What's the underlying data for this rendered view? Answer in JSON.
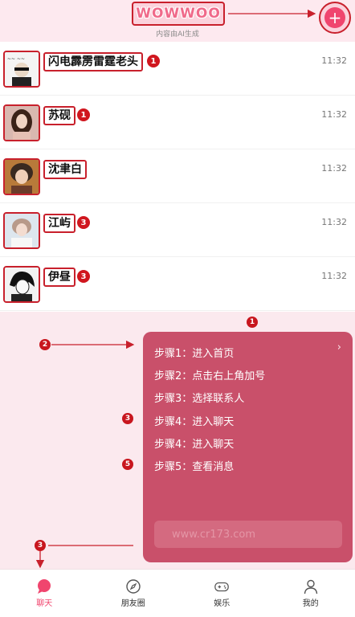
{
  "header": {
    "logo_text": "WOWWOO",
    "subtitle": "内容由AI生成",
    "plus_icon": "+",
    "plus_icon_name": "plus-icon"
  },
  "chats": [
    {
      "name": "闪电霹雳雷霆老头",
      "badge": "1",
      "time": "11:32"
    },
    {
      "name": "苏砚",
      "badge": "1",
      "time": "11:32"
    },
    {
      "name": "沈聿白",
      "badge": "",
      "time": "11:32"
    },
    {
      "name": "江屿",
      "badge": "3",
      "time": "11:32"
    },
    {
      "name": "伊昼",
      "badge": "3",
      "time": "11:32"
    }
  ],
  "panel": {
    "steps": [
      "步骤1：进入首页",
      "步骤2：点击右上角加号",
      "步骤3：选择联系人",
      "步骤4：进入聊天",
      "步骤4：进入聊天",
      "步骤5：查看消息"
    ],
    "chevron": "›",
    "input_placeholder": "www.cr173.com"
  },
  "markers": {
    "m1": "1",
    "m2": "2",
    "m3_panel": "3",
    "m5": "5",
    "m3_tab": "3"
  },
  "tabs": [
    {
      "label": "聊天",
      "icon": "chat-bubble-icon",
      "active": true
    },
    {
      "label": "朋友圈",
      "icon": "compass-icon",
      "active": false
    },
    {
      "label": "娱乐",
      "icon": "gamepad-icon",
      "active": false
    },
    {
      "label": "我的",
      "icon": "person-icon",
      "active": false
    }
  ],
  "colors": {
    "accent": "#f0456e",
    "annotation_red": "#c8202c",
    "panel_bg": "#c9506a",
    "page_bg": "#fbe9ee"
  }
}
